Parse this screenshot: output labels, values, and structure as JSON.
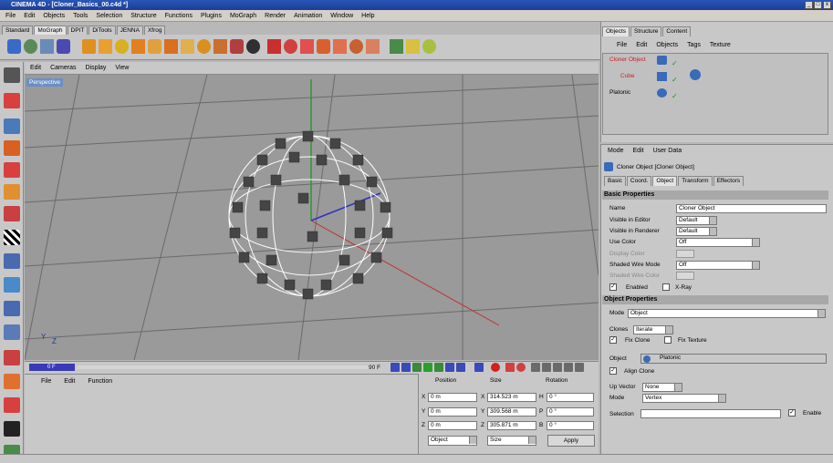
{
  "window": {
    "title": "CINEMA 4D - [Cloner_Basics_00.c4d *]",
    "buttons": [
      "_",
      "□",
      "x"
    ]
  },
  "menu": [
    "File",
    "Edit",
    "Objects",
    "Tools",
    "Selection",
    "Structure",
    "Functions",
    "Plugins",
    "MoGraph",
    "Render",
    "Animation",
    "Window",
    "Help"
  ],
  "palette_tabs": [
    "Standard",
    "MoGraph",
    "DPIT",
    "DiTools",
    "JENNA",
    "Xfrog"
  ],
  "viewport": {
    "menu": [
      "Edit",
      "Cameras",
      "Display",
      "View"
    ],
    "label": "Perspective"
  },
  "timeline": {
    "current_frame": "0 F",
    "end_frame": "90 F"
  },
  "bottom": {
    "menu": [
      "File",
      "Edit",
      "Function"
    ]
  },
  "coords": {
    "headers": [
      "Position",
      "Size",
      "Rotation"
    ],
    "axes_pos": [
      "X",
      "Y",
      "Z"
    ],
    "position": [
      "0 m",
      "0 m",
      "0 m"
    ],
    "size": [
      "314.523 m",
      "309.568 m",
      "305.871 m"
    ],
    "axes_rot": [
      "H",
      "P",
      "B"
    ],
    "rotation": [
      "0 °",
      "0 °",
      "0 °"
    ],
    "mode_left": "Object",
    "mode_right": "Size",
    "apply": "Apply"
  },
  "object_manager": {
    "tabs": [
      "Objects",
      "Structure",
      "Content"
    ],
    "menu": [
      "File",
      "Edit",
      "Objects",
      "Tags",
      "Texture"
    ],
    "items": [
      {
        "name": "Cloner Object",
        "color": "#cc2020"
      },
      {
        "name": "Cube",
        "color": "#cc2020"
      },
      {
        "name": "Platonic",
        "color": "#000000"
      }
    ]
  },
  "attributes": {
    "menu": [
      "Mode",
      "Edit",
      "User Data"
    ],
    "object_title": "Cloner Object [Cloner Object]",
    "tabs": [
      "Basic",
      "Coord.",
      "Object",
      "Transform",
      "Effectors"
    ],
    "basic_header": "Basic Properties",
    "name_label": "Name",
    "name_value": "Cloner Object",
    "visible_editor_label": "Visible in Editor",
    "visible_editor_value": "Default",
    "visible_renderer_label": "Visible in Renderer",
    "visible_renderer_value": "Default",
    "use_color_label": "Use Color",
    "use_color_value": "Off",
    "display_color_label": "Display Color",
    "shaded_wire_label": "Shaded Wire Mode",
    "shaded_wire_value": "Off",
    "shaded_wire_color_label": "Shaded Wire Color",
    "enabled_label": "Enabled",
    "xray_label": "X-Ray",
    "object_header": "Object Properties",
    "mode_label": "Mode",
    "mode_value": "Object",
    "clones_label": "Clones",
    "clones_value": "Iterate",
    "fix_clone_label": "Fix Clone",
    "fix_texture_label": "Fix Texture",
    "object_label": "Object",
    "object_value": "Platonic",
    "align_clone_label": "Align Clone",
    "up_vector_label": "Up Vector",
    "up_vector_value": "None",
    "mode2_label": "Mode",
    "mode2_value": "Vertex",
    "selection_label": "Selection",
    "enable_label": "Enable"
  },
  "colors": {
    "title_bar": "#1b3d96",
    "viewport": "#9a9a9a",
    "panel": "#c8c8c8",
    "accent_blue": "#3a3ab8"
  }
}
